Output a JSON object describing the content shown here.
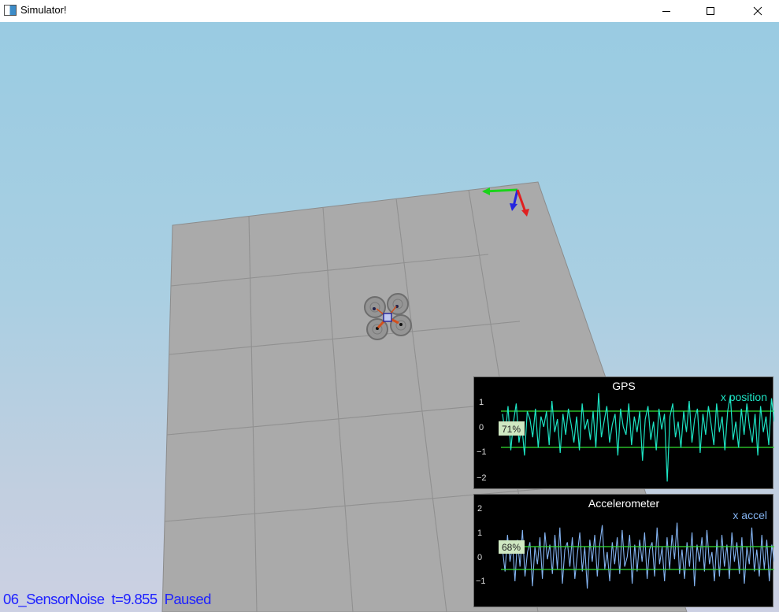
{
  "window": {
    "title": "Simulator!",
    "controls": {
      "minimize": "minimize",
      "maximize": "maximize",
      "close": "close"
    }
  },
  "status": {
    "scenario": "06_SensorNoise",
    "time": "t=9.855",
    "state": "Paused"
  },
  "plots": [
    {
      "title": "GPS",
      "legend": "x position",
      "yticks": [
        "1",
        "0",
        "−1",
        "−2"
      ],
      "percent": "71%",
      "colors": {
        "trace": "#1de4c4",
        "bounds": "#30e030",
        "bg": "#000000"
      }
    },
    {
      "title": "Accelerometer",
      "legend": "x accel",
      "yticks": [
        "2",
        "1",
        "0",
        "−1"
      ],
      "percent": "68%",
      "colors": {
        "trace": "#84b4f2",
        "bounds": "#30e030",
        "bg": "#000000"
      }
    }
  ],
  "chart_data": [
    {
      "type": "line",
      "title": "GPS",
      "series": [
        {
          "name": "x position",
          "values": [
            0.5,
            -0.3,
            0.8,
            -0.9,
            0.2,
            0.9,
            -0.6,
            0.1,
            -1.1,
            0.6,
            0.3,
            -0.4,
            0.7,
            -0.8,
            0.4,
            0.0,
            0.6,
            -0.7,
            1.0,
            -0.2,
            0.3,
            -1.0,
            0.5,
            -0.3,
            0.7,
            0.1,
            -0.6,
            0.4,
            -0.9,
            0.9,
            -0.1,
            0.3,
            -0.5,
            0.6,
            -0.8,
            1.3,
            -0.4,
            0.2,
            0.8,
            -0.6,
            0.1,
            0.5,
            -1.1,
            0.7,
            0.0,
            -0.3,
            0.9,
            -0.7,
            0.4,
            -0.2,
            0.6,
            -1.3,
            0.3,
            0.8,
            -0.5,
            0.2,
            -0.9,
            0.7,
            -0.1,
            0.5,
            -2.1,
            0.4,
            0.9,
            -0.4,
            0.2,
            -0.8,
            0.6,
            -0.2,
            1.0,
            -0.6,
            0.3,
            0.7,
            -1.0,
            0.5,
            -0.3,
            0.8,
            0.1,
            -0.7,
            0.9,
            -0.2,
            0.4,
            -0.9,
            0.6,
            1.2,
            -0.5,
            0.2,
            -0.8,
            0.7,
            -0.3,
            0.9,
            0.0,
            -0.6,
            0.5,
            -1.1,
            0.8,
            -0.2,
            0.4,
            -0.7,
            1.1,
            0.2
          ]
        }
      ],
      "ylim": [
        -2.3,
        1.7
      ],
      "bounds": [
        0.71,
        -0.71
      ],
      "yticks": [
        1,
        0,
        -1,
        -2
      ]
    },
    {
      "type": "line",
      "title": "Accelerometer",
      "series": [
        {
          "name": "x accel",
          "values": [
            0.3,
            -0.6,
            0.9,
            -0.2,
            0.5,
            -1.0,
            0.7,
            -0.4,
            1.1,
            -0.8,
            0.2,
            0.6,
            -1.2,
            0.4,
            -0.3,
            0.8,
            -0.9,
            1.0,
            -0.1,
            0.5,
            -0.7,
            0.9,
            -0.5,
            1.2,
            -1.1,
            0.3,
            0.6,
            -0.4,
            0.8,
            -0.9,
            0.1,
            1.0,
            -0.6,
            0.4,
            -1.3,
            0.7,
            -0.2,
            0.9,
            -0.8,
            0.5,
            1.3,
            -0.5,
            0.2,
            -1.0,
            0.6,
            -0.3,
            0.8,
            -0.7,
            1.1,
            -0.4,
            0.0,
            0.9,
            -1.1,
            0.5,
            -0.6,
            0.7,
            -0.2,
            1.0,
            -0.9,
            0.3,
            0.6,
            -0.8,
            1.2,
            -0.3,
            0.4,
            -1.0,
            0.8,
            -0.5,
            0.9,
            -0.1,
            1.4,
            -0.7,
            0.3,
            -0.9,
            0.6,
            -0.4,
            1.0,
            -1.2,
            0.5,
            -0.2,
            0.8,
            -0.6,
            1.1,
            -0.3,
            0.2,
            -1.0,
            0.7,
            -0.8,
            0.9,
            -0.4,
            0.5,
            -0.9,
            1.0,
            -0.2,
            0.6,
            -0.7,
            0.8,
            -1.1,
            0.4,
            -0.3,
            1.2,
            -0.6,
            0.3,
            -0.8,
            0.9,
            -0.5,
            0.7,
            -1.0,
            0.5,
            -0.2
          ]
        }
      ],
      "ylim": [
        -1.7,
        2.3
      ],
      "bounds": [
        0.68,
        -0.68
      ],
      "yticks": [
        2,
        1,
        0,
        -1
      ]
    }
  ]
}
